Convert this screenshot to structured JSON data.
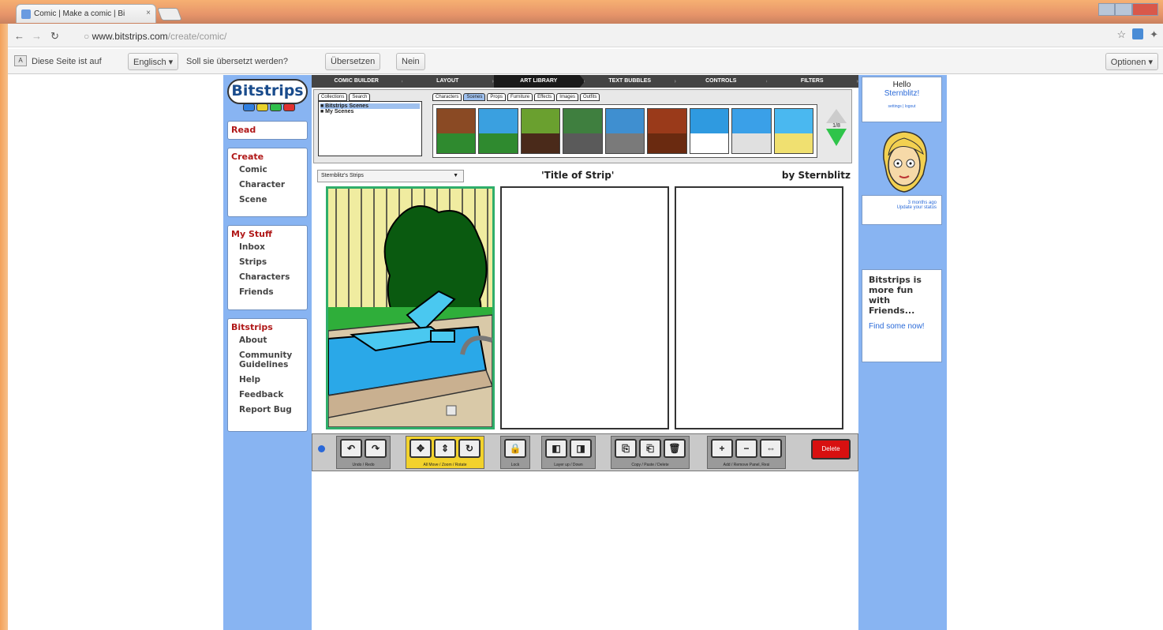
{
  "browser": {
    "tab_title": "Comic | Make a comic | Bi",
    "tab_close": "×",
    "url_domain": "www.bitstrips.com",
    "url_path": "/create/comic/",
    "back_icon": "arrow-left",
    "reload_icon": "refresh",
    "star_icon": "☆"
  },
  "translate": {
    "icon_text": "A",
    "text1": "Diese Seite ist auf",
    "language": "Englisch ▾",
    "text2": "Soll sie übersetzt werden?",
    "translate_button": "Übersetzen",
    "no_button": "Nein",
    "options_button": "Optionen ▾"
  },
  "sidebar": {
    "logo": "Bitstrips",
    "logo_colors": [
      "#2f7fe0",
      "#e8d22a",
      "#2fbe4a",
      "#e03030"
    ],
    "read": "Read",
    "create": {
      "heading": "Create",
      "items": [
        "Comic",
        "Character",
        "Scene"
      ]
    },
    "mystuff": {
      "heading": "My Stuff",
      "items": [
        "Inbox",
        "Strips",
        "Characters",
        "Friends"
      ]
    },
    "bitstrips": {
      "heading": "Bitstrips",
      "items": [
        "About",
        "Community Guidelines",
        "Help",
        "Feedback",
        "Report Bug"
      ]
    }
  },
  "top_menu": {
    "tabs": [
      "COMIC BUILDER",
      "LAYOUT",
      "ART LIBRARY",
      "TEXT BUBBLES",
      "CONTROLS",
      "FILTERS"
    ],
    "active": "ART LIBRARY"
  },
  "art_library": {
    "collection_tabs": [
      "Collections",
      "Search"
    ],
    "collections": [
      "■ Bitstrips Scenes",
      "■ My Scenes"
    ],
    "category_tabs": [
      "Characters",
      "Scenes",
      "Props",
      "Furniture",
      "Effects",
      "Images",
      "Outfits"
    ],
    "active_category": "Scenes",
    "thumb_colors": [
      [
        "#8a4a24",
        "#2f8a2f"
      ],
      [
        "#3aa0e0",
        "#2f8a2f"
      ],
      [
        "#6aa02f",
        "#4a2a1a"
      ],
      [
        "#3f7f3f",
        "#5a5a5a"
      ],
      [
        "#3f8fd0",
        "#7a7a7a"
      ],
      [
        "#9a3a1a",
        "#6a2a10"
      ],
      [
        "#2f9ae0",
        "#ffffff"
      ],
      [
        "#3aa0e8",
        "#e0e0e0"
      ],
      [
        "#4ab8f0",
        "#f0e070"
      ]
    ],
    "page_indicator": "1/8"
  },
  "strip": {
    "selector": "Sternblitz's Strips",
    "title": "'Title of Strip'",
    "by": "by Sternblitz"
  },
  "toolbar": {
    "groups": [
      {
        "label": "Undo / Redo",
        "buttons": [
          "↶",
          "↷"
        ]
      },
      {
        "label": "All Move / Zoom / Rotate",
        "buttons": [
          "✥",
          "⇕",
          "↻"
        ]
      },
      {
        "label": "Lock",
        "buttons": [
          "🔒"
        ]
      },
      {
        "label": "Layer up / Down",
        "buttons": [
          "◧",
          "◨"
        ]
      },
      {
        "label": "Copy / Paste / Delete",
        "buttons": [
          "⎘",
          "⎗",
          "🗑"
        ]
      },
      {
        "label": "Add / Remove Panel, Resi",
        "buttons": [
          "+",
          "−",
          "⇔"
        ]
      }
    ],
    "red_button": "Delete"
  },
  "right": {
    "hello": "Hello",
    "user": "Sternblitz!",
    "links": "settings | logout",
    "bubble_time": "3 months ago",
    "bubble_link": "Update your status",
    "fun_heading": "Bitstrips is more fun with Friends...",
    "fun_link": "Find some now!"
  }
}
